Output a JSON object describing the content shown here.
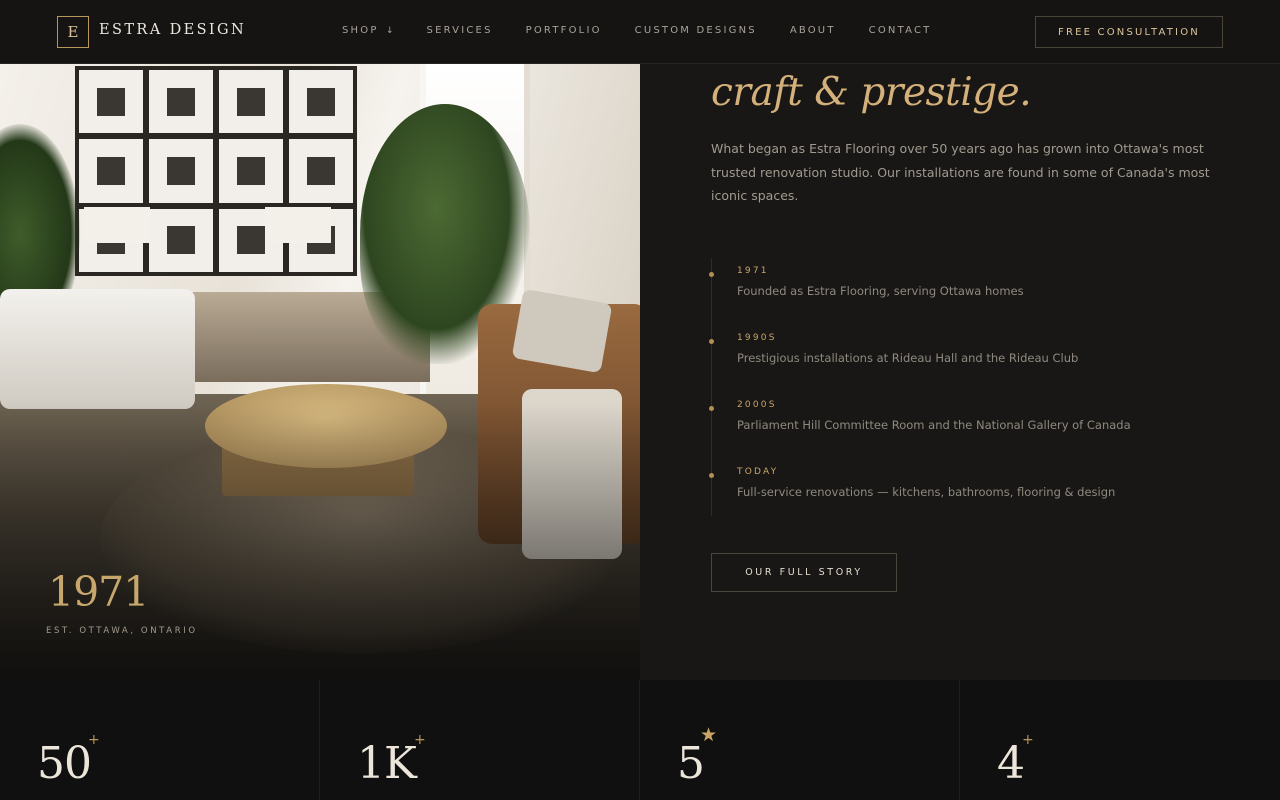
{
  "brand": {
    "mark": "E",
    "name": "ESTRA DESIGN"
  },
  "nav": {
    "items": [
      {
        "label": "SHOP",
        "caret": "↓"
      },
      {
        "label": "SERVICES"
      },
      {
        "label": "PORTFOLIO"
      },
      {
        "label": "CUSTOM DESIGNS"
      },
      {
        "label": "ABOUT"
      },
      {
        "label": "CONTACT"
      }
    ],
    "cta": "FREE CONSULTATION"
  },
  "hero_photo": {
    "year": "1971",
    "caption": "EST. OTTAWA, ONTARIO"
  },
  "about": {
    "headline": "craft & prestige.",
    "intro": "What began as Estra Flooring over 50 years ago has grown into Ottawa's most trusted renovation studio. Our installations are found in some of Canada's most iconic spaces.",
    "timeline": [
      {
        "year": "1971",
        "desc": "Founded as Estra Flooring, serving Ottawa homes"
      },
      {
        "year": "1990S",
        "desc": "Prestigious installations at Rideau Hall and the Rideau Club"
      },
      {
        "year": "2000S",
        "desc": "Parliament Hill Committee Room and the National Gallery of Canada"
      },
      {
        "year": "TODAY",
        "desc": "Full-service renovations — kitchens, bathrooms, flooring & design"
      }
    ],
    "story_button": "OUR FULL STORY"
  },
  "stats": [
    {
      "value": "50",
      "suffix": "+"
    },
    {
      "value": "1K",
      "suffix": "+"
    },
    {
      "value": "5",
      "suffix": "★"
    },
    {
      "value": "4",
      "suffix": "+"
    }
  ],
  "colors": {
    "accent": "#c9a56a",
    "background": "#181715",
    "nav_bg": "#151413"
  }
}
